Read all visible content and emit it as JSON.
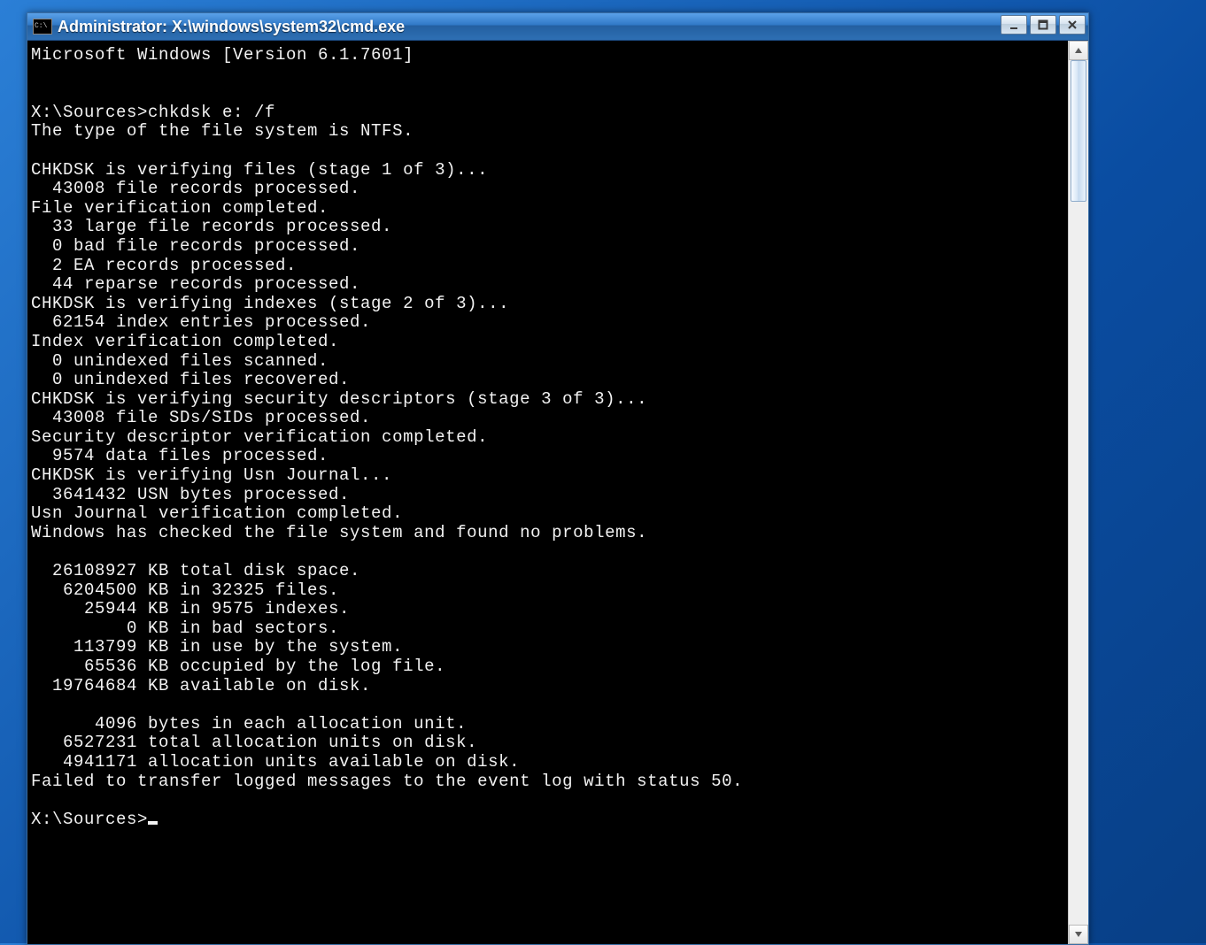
{
  "window": {
    "title": "Administrator: X:\\windows\\system32\\cmd.exe"
  },
  "console": {
    "lines": [
      "Microsoft Windows [Version 6.1.7601]",
      "",
      "",
      "X:\\Sources>chkdsk e: /f",
      "The type of the file system is NTFS.",
      "",
      "CHKDSK is verifying files (stage 1 of 3)...",
      "  43008 file records processed.",
      "File verification completed.",
      "  33 large file records processed.",
      "  0 bad file records processed.",
      "  2 EA records processed.",
      "  44 reparse records processed.",
      "CHKDSK is verifying indexes (stage 2 of 3)...",
      "  62154 index entries processed.",
      "Index verification completed.",
      "  0 unindexed files scanned.",
      "  0 unindexed files recovered.",
      "CHKDSK is verifying security descriptors (stage 3 of 3)...",
      "  43008 file SDs/SIDs processed.",
      "Security descriptor verification completed.",
      "  9574 data files processed.",
      "CHKDSK is verifying Usn Journal...",
      "  3641432 USN bytes processed.",
      "Usn Journal verification completed.",
      "Windows has checked the file system and found no problems.",
      "",
      "  26108927 KB total disk space.",
      "   6204500 KB in 32325 files.",
      "     25944 KB in 9575 indexes.",
      "         0 KB in bad sectors.",
      "    113799 KB in use by the system.",
      "     65536 KB occupied by the log file.",
      "  19764684 KB available on disk.",
      "",
      "      4096 bytes in each allocation unit.",
      "   6527231 total allocation units on disk.",
      "   4941171 allocation units available on disk.",
      "Failed to transfer logged messages to the event log with status 50.",
      "",
      "X:\\Sources>"
    ]
  }
}
